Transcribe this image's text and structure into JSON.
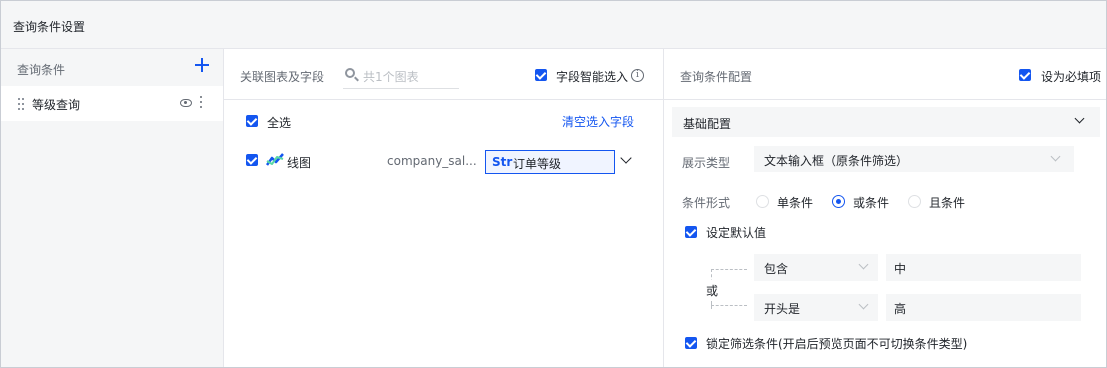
{
  "window": {
    "title": "查询条件设置"
  },
  "left_panel": {
    "header": "查询条件",
    "items": [
      {
        "label": "等级查询"
      }
    ]
  },
  "middle_panel": {
    "header": "关联图表及字段",
    "search_placeholder": "共1个图表",
    "smart_select_label": "字段智能选入",
    "select_all_label": "全选",
    "clear_link": "清空选入字段",
    "charts": [
      {
        "name": "线图",
        "table": "company_sal...",
        "field_type": "Str",
        "field_name": "订单等级",
        "checked": true
      }
    ]
  },
  "right_panel": {
    "header": "查询条件配置",
    "required_label": "设为必填项",
    "section_title": "基础配置",
    "display_type_label": "展示类型",
    "display_type_value": "文本输入框（原条件筛选）",
    "condition_form_label": "条件形式",
    "condition_options": [
      "单条件",
      "或条件",
      "且条件"
    ],
    "condition_selected": "或条件",
    "default_value_label": "设定默认值",
    "logic_label": "或",
    "conditions": [
      {
        "operator": "包含",
        "value": "中"
      },
      {
        "operator": "开头是",
        "value": "高"
      }
    ],
    "lock_label": "锁定筛选条件(开启后预览页面不可切换条件类型)"
  },
  "colors": {
    "accent": "#1456f0",
    "panel_bg": "#f5f6f7",
    "border": "#e5e6eb"
  }
}
